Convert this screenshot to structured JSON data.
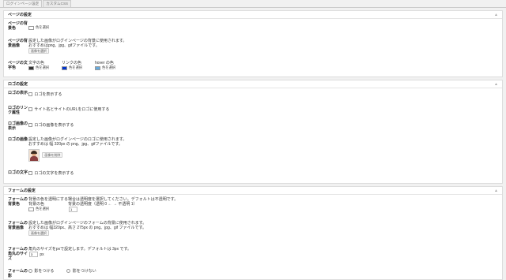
{
  "tabs": [
    "ログインページ設定",
    "カスタムCSS"
  ],
  "page": {
    "title": "ページの設定",
    "bg_color": {
      "label": "ページの背景色",
      "button": "色を選択"
    },
    "bg_image": {
      "label": "ページの背景画像",
      "desc1": "設定した画像がログインページの背景に使用されます。",
      "desc2": "おすすめはpng、jpg、gifファイルです。",
      "button": "画像を選択"
    },
    "text_color": {
      "label": "ページの文字色",
      "cols": [
        {
          "title": "文字の色",
          "button": "色を選択",
          "swatch": "#333333"
        },
        {
          "title": "リンクの色",
          "button": "色を選択",
          "swatch": "#0033cc"
        },
        {
          "title": "hover の色",
          "button": "色を選択",
          "swatch": "#66aadd"
        }
      ]
    }
  },
  "logo": {
    "title": "ロゴの設定",
    "show": {
      "label": "ロゴの表示",
      "text": "ロゴを表示する"
    },
    "link": {
      "label": "ロゴのリンク属性",
      "text": "サイト名とサイトのURLをロゴに使用する"
    },
    "img_show": {
      "label": "ロゴ画像の表示",
      "text": "ロゴの画像を表示する"
    },
    "image": {
      "label": "ロゴの画像",
      "desc1": "設定した画像がログインページのロゴに使用されます。",
      "desc2": "おすすめは 幅 320px の png、jpg、gifファイルです。",
      "button": "画像を削除"
    },
    "text": {
      "label": "ロゴの文字",
      "text": "ロゴの文字を表示する"
    }
  },
  "form": {
    "title": "フォームの設定",
    "bg": {
      "label": "フォームの背景色",
      "desc": "背景の色を透明にする場合は透明度を選択してください。デフォルトは不透明です。",
      "col1": "背景の色",
      "col2": "背景の透明度（透明 0 ← → 不透明 1）",
      "button": "色を選択",
      "opacity": "1"
    },
    "bg_image": {
      "label": "フォームの背景画像",
      "desc1": "設定した画像がログインページのフォームの背景に使用されます。",
      "desc2": "おすすめは 幅320px、高さ 275px の png、jpg、gif ファイルです。",
      "button": "画像を選択"
    },
    "radius": {
      "label": "フォームの角丸のサイズ",
      "desc": "角丸のサイズをpxで設定します。デフォルトは 3px です。",
      "value": "3",
      "unit": "px"
    },
    "shadow": {
      "label": "フォームの影",
      "opt1": "影をつける",
      "opt2": "影をつけない"
    }
  },
  "colors": {
    "accent": "#0073aa"
  }
}
